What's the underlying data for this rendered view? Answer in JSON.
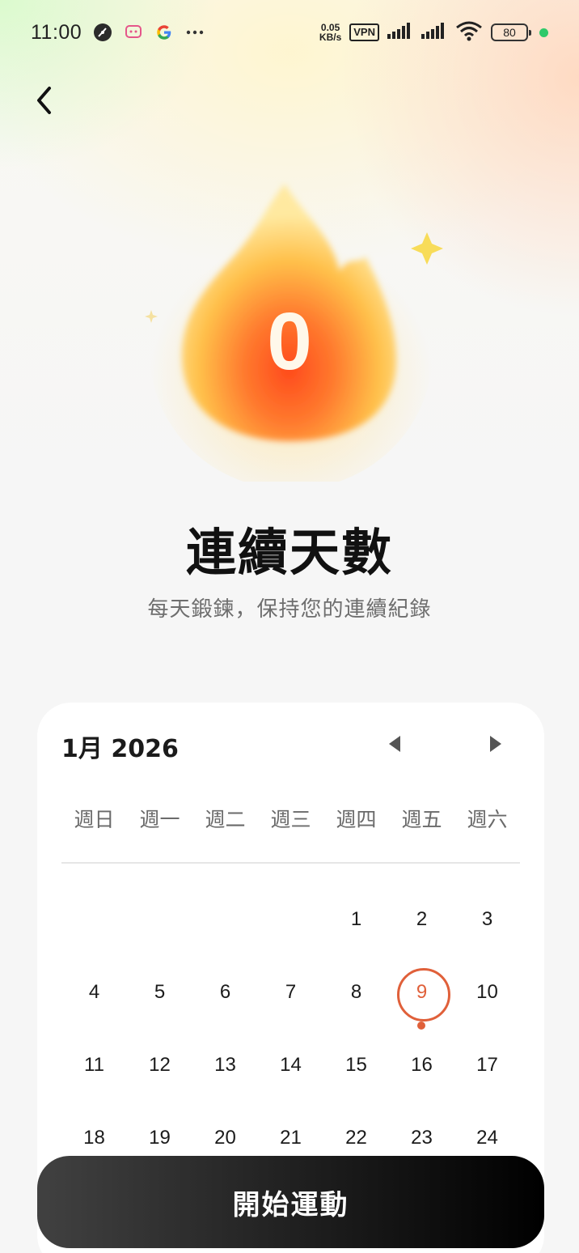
{
  "status_bar": {
    "time": "11:00",
    "net_speed_value": "0.05",
    "net_speed_unit": "KB/s",
    "vpn": "VPN",
    "battery": "80",
    "left_icons": [
      "clock-app-icon",
      "chat-app-icon",
      "google-icon",
      "more-dots-icon"
    ]
  },
  "streak": {
    "count": "0",
    "title": "連續天數",
    "subtitle": "每天鍛鍊，保持您的連續紀錄"
  },
  "calendar": {
    "month_label": "1月 2026",
    "weekdays": [
      "週日",
      "週一",
      "週二",
      "週三",
      "週四",
      "週五",
      "週六"
    ],
    "today": 9,
    "days": [
      [
        "",
        "",
        "",
        "",
        "1",
        "2",
        "3"
      ],
      [
        "4",
        "5",
        "6",
        "7",
        "8",
        "9",
        "10"
      ],
      [
        "11",
        "12",
        "13",
        "14",
        "15",
        "16",
        "17"
      ],
      [
        "18",
        "19",
        "20",
        "21",
        "22",
        "23",
        "24"
      ]
    ]
  },
  "start_button": {
    "label": "開始運動"
  },
  "colors": {
    "accent": "#e0603a",
    "flame_core": "#ff5a1f",
    "flame_outer": "#ffd04a",
    "button_dark": "#000000"
  }
}
